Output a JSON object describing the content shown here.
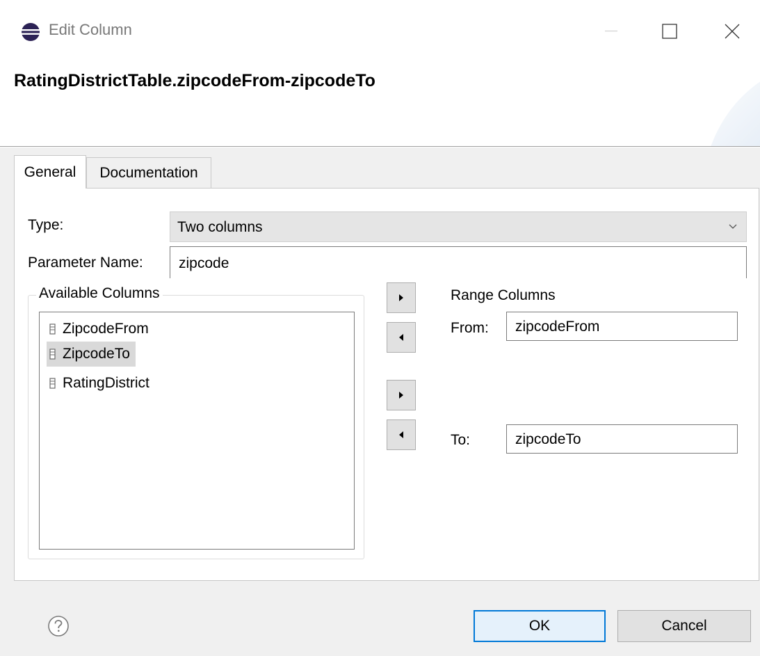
{
  "window": {
    "title": "Edit Column",
    "icon": "eclipse-app-icon",
    "controls": [
      "minimize-icon",
      "maximize-icon",
      "close-icon"
    ]
  },
  "header": {
    "title": "RatingDistrictTable.zipcodeFrom-zipcodeTo"
  },
  "tabs": [
    {
      "label": "General",
      "selected": true
    },
    {
      "label": "Documentation",
      "selected": false
    }
  ],
  "form": {
    "type_label": "Type:",
    "type_value": "Two columns",
    "param_label": "Parameter Name:",
    "param_value": "zipcode"
  },
  "available_columns": {
    "title": "Available Columns",
    "items": [
      {
        "label": "ZipcodeFrom",
        "selected": false
      },
      {
        "label": "ZipcodeTo",
        "selected": true
      },
      {
        "label": "RatingDistrict",
        "selected": false
      }
    ]
  },
  "range_columns": {
    "title": "Range Columns",
    "from_label": "From:",
    "from_value": "zipcodeFrom",
    "to_label": "To:",
    "to_value": "zipcodeTo"
  },
  "footer": {
    "ok_label": "OK",
    "cancel_label": "Cancel"
  },
  "colors": {
    "default_button_border": "#0078d7",
    "selection": "#d9d9d9"
  }
}
